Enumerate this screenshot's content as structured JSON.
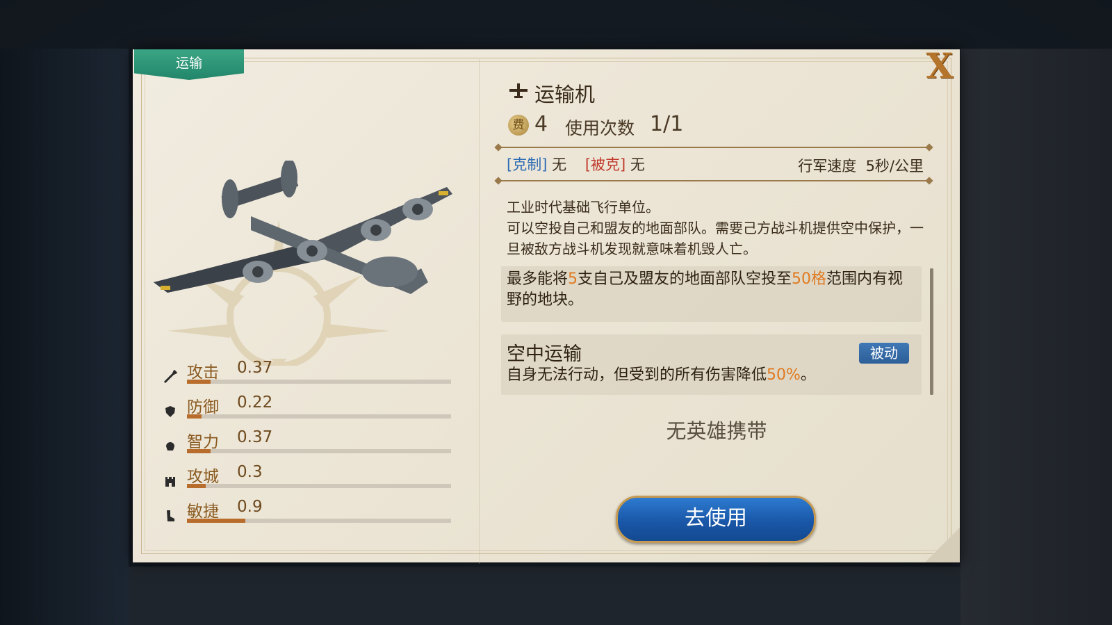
{
  "tag": {
    "label": "运输"
  },
  "close": {
    "label": "X"
  },
  "unit": {
    "icon": "plane-icon",
    "name": "运输机"
  },
  "cost": {
    "coin_label": "费",
    "value": "4",
    "uses_label": "使用次数",
    "uses_value": "1/1"
  },
  "counter": {
    "counters_label": "[克制]",
    "counters_value": "无",
    "countered_label": "[被克]",
    "countered_value": "无",
    "speed_label": "行军速度",
    "speed_value": "5秒/公里"
  },
  "description": {
    "line1": "工业时代基础飞行单位。",
    "line2": "可以空投自己和盟友的地面部队。需要己方战斗机提供空中保护，一旦被敌方战斗机发现就意味着机毁人亡。"
  },
  "skills": [
    {
      "text_a": "最多能将",
      "hl_a": "5",
      "text_b": "支自己及盟友的地面部队空投至",
      "hl_b": "50格",
      "text_c": "范围内有视野的地块。"
    },
    {
      "name": "空中运输",
      "badge": "被动",
      "text_a": "自身无法行动，但受到的所有伤害降低",
      "hl_a": "50%",
      "text_b": "。"
    }
  ],
  "stats": [
    {
      "name": "攻击",
      "value": "0.37",
      "icon": "sword-icon",
      "fill": 0.09
    },
    {
      "name": "防御",
      "value": "0.22",
      "icon": "shield-icon",
      "fill": 0.055
    },
    {
      "name": "智力",
      "value": "0.37",
      "icon": "brain-icon",
      "fill": 0.09
    },
    {
      "name": "攻城",
      "value": "0.3",
      "icon": "castle-icon",
      "fill": 0.07
    },
    {
      "name": "敏捷",
      "value": "0.9",
      "icon": "boot-icon",
      "fill": 0.22
    }
  ],
  "hero": {
    "text": "无英雄携带"
  },
  "action": {
    "label": "去使用"
  },
  "colors": {
    "accent_orange": "#e07a20",
    "tag_green": "#2a9a78",
    "button_blue": "#1a57a8",
    "passive_badge": "#2d5e98"
  }
}
